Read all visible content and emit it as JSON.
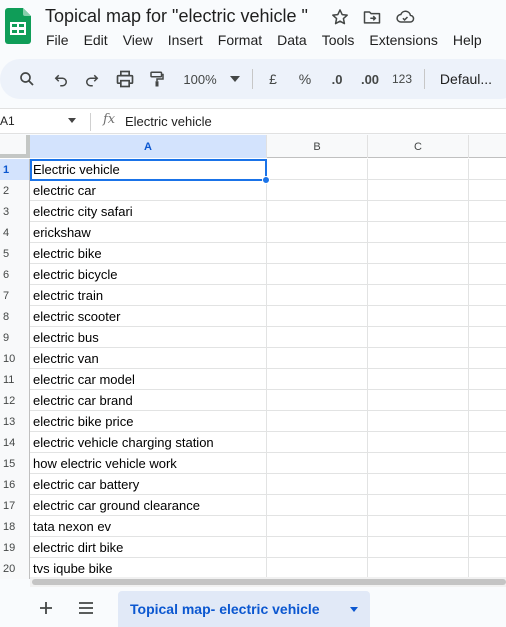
{
  "app": {
    "doc_title": "Topical map for \"electric vehicle \"",
    "menu": [
      "File",
      "Edit",
      "View",
      "Insert",
      "Format",
      "Data",
      "Tools",
      "Extensions",
      "Help"
    ]
  },
  "toolbar": {
    "zoom": "100%",
    "currency": "£",
    "percent": "%",
    "dec_decrease": ".0",
    "dec_increase": ".00",
    "number_format": "123",
    "font": "Defaul..."
  },
  "formula_bar": {
    "cell_ref": "A1",
    "fx": "fx",
    "value": "Electric vehicle"
  },
  "grid": {
    "columns": [
      "A",
      "B",
      "C"
    ],
    "active_column": "A",
    "rows": [
      {
        "num": "1",
        "a": "Electric vehicle"
      },
      {
        "num": "2",
        "a": "electric car"
      },
      {
        "num": "3",
        "a": "electric city safari"
      },
      {
        "num": "4",
        "a": "erickshaw"
      },
      {
        "num": "5",
        "a": "electric bike"
      },
      {
        "num": "6",
        "a": "electric bicycle"
      },
      {
        "num": "7",
        "a": "electric train"
      },
      {
        "num": "8",
        "a": "electric scooter"
      },
      {
        "num": "9",
        "a": "electric bus"
      },
      {
        "num": "10",
        "a": "electric van"
      },
      {
        "num": "11",
        "a": "electric car model"
      },
      {
        "num": "12",
        "a": "electric car brand"
      },
      {
        "num": "13",
        "a": "electric bike price"
      },
      {
        "num": "14",
        "a": "electric vehicle charging station"
      },
      {
        "num": "15",
        "a": "how electric vehicle work"
      },
      {
        "num": "16",
        "a": "electric car battery"
      },
      {
        "num": "17",
        "a": "electric car ground clearance"
      },
      {
        "num": "18",
        "a": "tata nexon ev"
      },
      {
        "num": "19",
        "a": "electric dirt bike"
      },
      {
        "num": "20",
        "a": "tvs iqube bike"
      }
    ]
  },
  "sheets": {
    "add_icon": "plus-icon",
    "list_icon": "menu-icon",
    "active_tab": "Topical map- electric vehicle"
  },
  "colors": {
    "accent": "#0b57d0",
    "selection": "#1a73e8",
    "header_active": "#d3e3fd",
    "sheets_green": "#0f9d58"
  }
}
